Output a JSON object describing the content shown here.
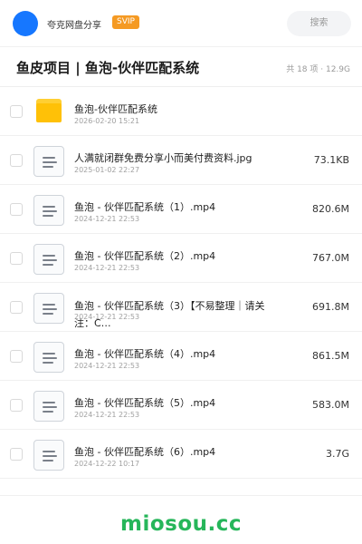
{
  "header": {
    "user_name": "夸克网盘分享",
    "badge": "SVIP",
    "search_placeholder": "搜索"
  },
  "title_bar": {
    "title": "鱼皮项目 | 鱼泡-伙伴匹配系统",
    "meta": "共 18 项 · 12.9G"
  },
  "files": [
    {
      "type": "folder",
      "icon": "folder-icon",
      "name": "鱼泡-伙伴匹配系统",
      "date": "2026-02-20 15:21",
      "size": ""
    },
    {
      "type": "file",
      "icon": "file-icon",
      "name": "人满就闭群免费分享小而美付费资料.jpg",
      "date": "2025-01-02 22:27",
      "size": "73.1KB"
    },
    {
      "type": "file",
      "icon": "file-icon",
      "name": "鱼泡 - 伙伴匹配系统（1）.mp4",
      "date": "2024-12-21 22:53",
      "size": "820.6M"
    },
    {
      "type": "file",
      "icon": "file-icon",
      "name": "鱼泡 - 伙伴匹配系统（2）.mp4",
      "date": "2024-12-21 22:53",
      "size": "767.0M"
    },
    {
      "type": "file",
      "icon": "file-icon",
      "name": "鱼泡 - 伙伴匹配系统（3）【不易整理｜请关注：C…",
      "date": "2024-12-21 22:53",
      "size": "691.8M"
    },
    {
      "type": "file",
      "icon": "file-icon",
      "name": "鱼泡 - 伙伴匹配系统（4）.mp4",
      "date": "2024-12-21 22:53",
      "size": "861.5M"
    },
    {
      "type": "file",
      "icon": "file-icon",
      "name": "鱼泡 - 伙伴匹配系统（5）.mp4",
      "date": "2024-12-21 22:53",
      "size": "583.0M"
    },
    {
      "type": "file",
      "icon": "file-icon",
      "name": "鱼泡 - 伙伴匹配系统（6）.mp4",
      "date": "2024-12-22 10:17",
      "size": "3.7G"
    }
  ],
  "footer": {
    "watermark": "miosou.cc"
  },
  "colors": {
    "avatar": "#1677ff",
    "svip_badge": "#f59a23",
    "folder": "#ffc107",
    "watermark": "#26b65a"
  }
}
